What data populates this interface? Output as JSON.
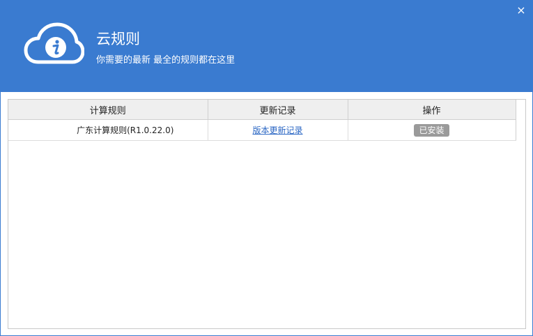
{
  "window": {
    "close_glyph": "×"
  },
  "header": {
    "title": "云规则",
    "subtitle": "你需要的最新 最全的规则都在这里",
    "logo_icon": "cloud-info-icon",
    "background_color": "#3a7bd0"
  },
  "table": {
    "columns": [
      "计算规则",
      "更新记录",
      "操作"
    ],
    "rows": [
      {
        "name": "广东计算规则(R1.0.22.0)",
        "history_link": "版本更新记录",
        "action_label": "已安装"
      }
    ]
  }
}
